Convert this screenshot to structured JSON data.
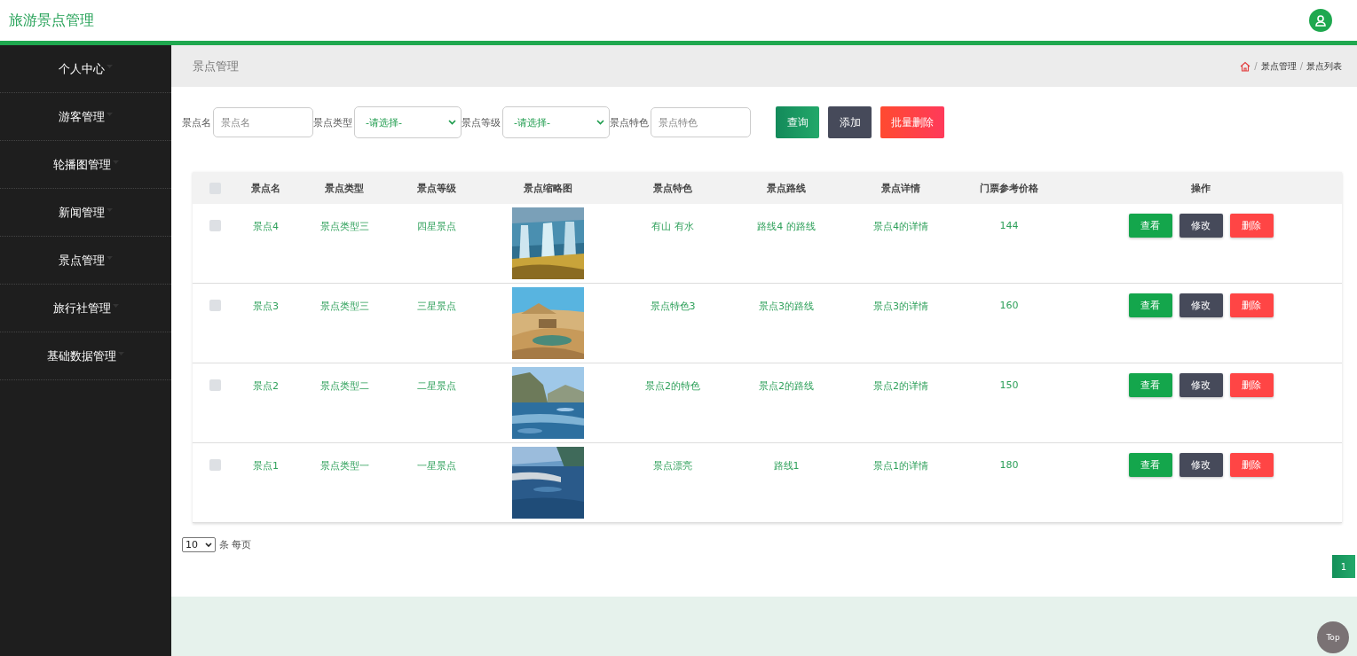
{
  "header": {
    "title": "旅游景点管理"
  },
  "sidebar": {
    "items": [
      {
        "label": "个人中心"
      },
      {
        "label": "游客管理"
      },
      {
        "label": "轮播图管理"
      },
      {
        "label": "新闻管理"
      },
      {
        "label": "景点管理"
      },
      {
        "label": "旅行社管理"
      },
      {
        "label": "基础数据管理"
      }
    ]
  },
  "page_bar": {
    "title": "景点管理",
    "breadcrumb": [
      {
        "separator": "/",
        "label": "景点管理"
      },
      {
        "separator": "/",
        "label": "景点列表"
      }
    ]
  },
  "filters": [
    {
      "kind": "input",
      "label": "景点名",
      "placeholder": "景点名"
    },
    {
      "kind": "select",
      "label": "景点类型",
      "value": "-请选择-"
    },
    {
      "kind": "select",
      "label": "景点等级",
      "value": "-请选择-"
    },
    {
      "kind": "input",
      "label": "景点特色",
      "placeholder": "景点特色"
    }
  ],
  "filter_buttons": [
    {
      "kind": "search",
      "label": "查询"
    },
    {
      "kind": "add",
      "label": "添加"
    },
    {
      "kind": "delete",
      "label": "批量删除"
    }
  ],
  "table": {
    "select_all_checked": false,
    "columns": [
      "景点名",
      "景点类型",
      "景点等级",
      "景点缩略图",
      "景点特色",
      "景点路线",
      "景点详情",
      "门票参考价格",
      "操作"
    ],
    "rows": [
      {
        "checked": false,
        "cells": [
          "景点4",
          "景点类型三",
          "四星景点",
          {
            "kind": "picture"
          },
          "有山 有水",
          "路线4 的路线",
          "景点4的详情",
          "144",
          {
            "kind": "actions",
            "buttons": [
              "查看",
              "修改",
              "删除"
            ]
          }
        ]
      },
      {
        "checked": false,
        "cells": [
          "景点3",
          "景点类型三",
          "三星景点",
          {
            "kind": "picture"
          },
          "景点特色3",
          "景点3的路线",
          "景点3的详情",
          "160",
          {
            "kind": "actions",
            "buttons": [
              "查看",
              "修改",
              "删除"
            ]
          }
        ]
      },
      {
        "checked": false,
        "cells": [
          "景点2",
          "景点类型二",
          "二星景点",
          {
            "kind": "picture"
          },
          "景点2的特色",
          "景点2的路线",
          "景点2的详情",
          "150",
          {
            "kind": "actions",
            "buttons": [
              "查看",
              "修改",
              "删除"
            ]
          }
        ]
      },
      {
        "checked": false,
        "cells": [
          "景点1",
          "景点类型一",
          "一星景点",
          {
            "kind": "picture"
          },
          "景点漂亮",
          "路线1",
          "景点1的详情",
          "180",
          {
            "kind": "actions",
            "buttons": [
              "查看",
              "修改",
              "删除"
            ]
          }
        ]
      }
    ]
  },
  "page_size": {
    "value": "10",
    "label": "条 每页"
  },
  "pagination": [
    {
      "label": "1",
      "selected": true
    }
  ],
  "back_to_top": "Top"
}
